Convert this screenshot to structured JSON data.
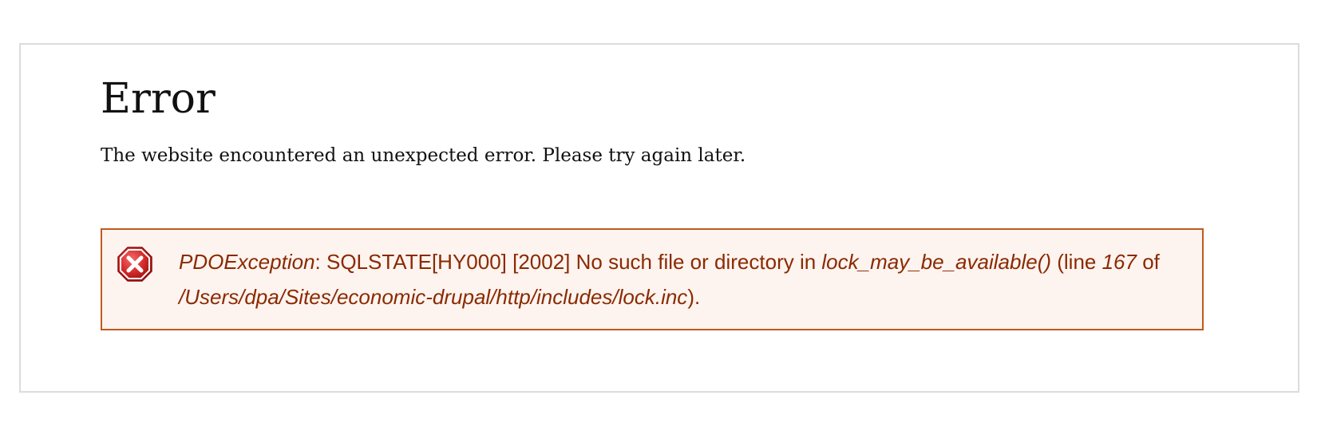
{
  "page": {
    "title": "Error",
    "intro": "The website encountered an unexpected error. Please try again later."
  },
  "error": {
    "icon": "error-x-icon",
    "exception_type": "PDOException",
    "separator": ": ",
    "message": "SQLSTATE[HY000] [2002] No such file or directory in ",
    "function": "lock_may_be_available()",
    "line_prefix": " (line ",
    "line_number": "167",
    "of_text": " of ",
    "file_path": "/Users/dpa/Sites/economic-drupal/http/includes/lock.inc",
    "suffix": ")."
  },
  "colors": {
    "error_border": "#c05a1f",
    "error_background": "#fdf3ef",
    "error_text": "#8a2a00",
    "icon_red": "#d42a2a"
  }
}
